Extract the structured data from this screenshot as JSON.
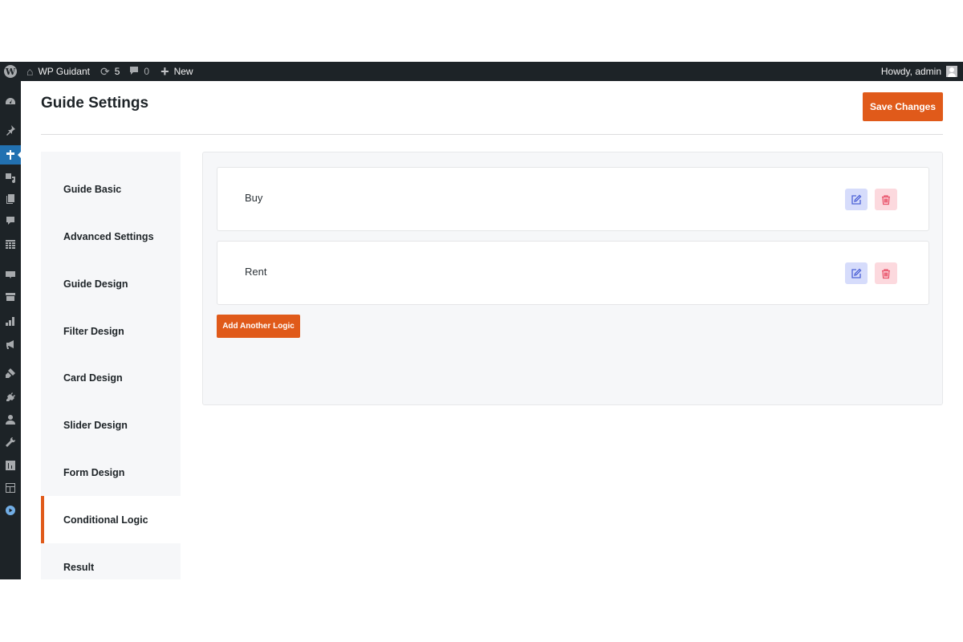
{
  "adminbar": {
    "site_name": "WP Guidant",
    "updates_count": "5",
    "comments_count": "0",
    "new_label": "New",
    "howdy": "Howdy, admin",
    "icons": [
      "wordpress-logo-icon",
      "home-icon",
      "updates-icon",
      "comment-icon",
      "plus-icon",
      "user-avatar-icon"
    ]
  },
  "admin_menu": {
    "items": [
      {
        "icon": "dashboard-icon"
      },
      {
        "icon": "pin-icon"
      },
      {
        "icon": "guidant-signpost-icon",
        "active": true
      },
      {
        "icon": "media-icon"
      },
      {
        "icon": "pages-icon"
      },
      {
        "icon": "comments-icon"
      },
      {
        "icon": "table-icon"
      },
      {
        "icon": "woo-icon",
        "label": "WOO"
      },
      {
        "icon": "archive-icon"
      },
      {
        "icon": "analytics-icon"
      },
      {
        "icon": "marketing-megaphone-icon"
      },
      {
        "icon": "appearance-brush-icon"
      },
      {
        "icon": "plugins-icon"
      },
      {
        "icon": "users-icon"
      },
      {
        "icon": "tools-wrench-icon"
      },
      {
        "icon": "settings-sliders-icon"
      },
      {
        "icon": "layout-icon"
      },
      {
        "icon": "play-circle-icon"
      }
    ]
  },
  "header": {
    "title": "Guide Settings",
    "save_label": "Save Changes"
  },
  "settings_nav": {
    "items": [
      {
        "label": "Guide Basic"
      },
      {
        "label": "Advanced Settings"
      },
      {
        "label": "Guide Design"
      },
      {
        "label": "Filter Design"
      },
      {
        "label": "Card Design"
      },
      {
        "label": "Slider Design"
      },
      {
        "label": "Form Design"
      },
      {
        "label": "Conditional Logic",
        "active": true
      },
      {
        "label": "Result"
      }
    ]
  },
  "logic": {
    "rows": [
      {
        "label": "Buy"
      },
      {
        "label": "Rent"
      }
    ],
    "add_label": "Add Another Logic"
  },
  "colors": {
    "accent": "#e05a1a",
    "admin_bar": "#1d2327",
    "menu_active": "#2271b1",
    "edit_bg": "#d6dcfb",
    "edit_icon": "#4d62d6",
    "delete_bg": "#fcd9de",
    "delete_icon": "#e9546b"
  }
}
